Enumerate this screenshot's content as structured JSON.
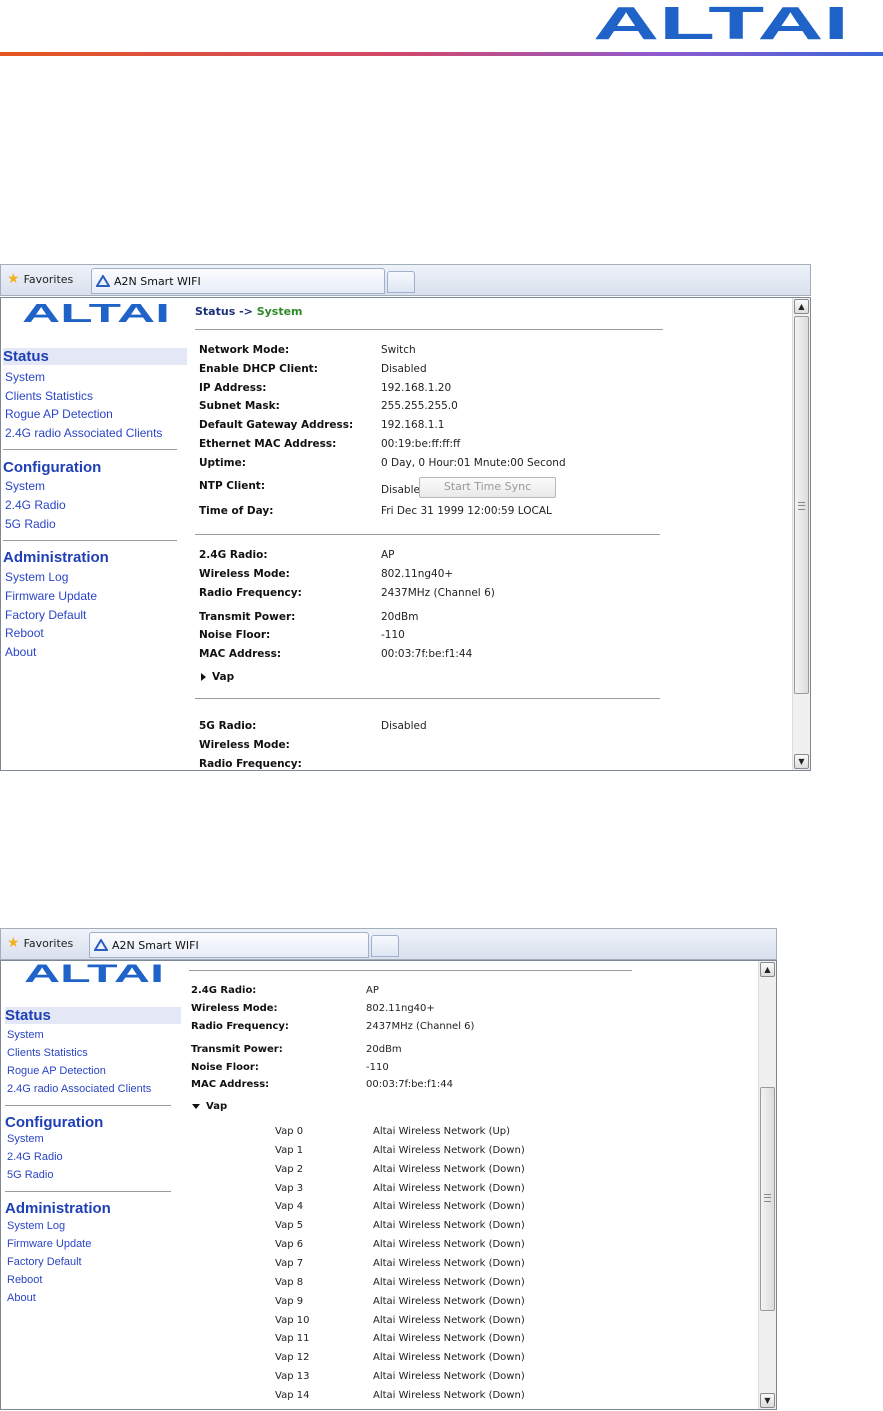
{
  "page_logo": "ALTAI",
  "brand_colors": {
    "logo_blue": "#1f63c9",
    "link": "#2b45c6",
    "heading": "#1f3fb5",
    "crumb_green": "#2f8a27"
  },
  "browser": {
    "favorites_label": "Favorites",
    "tab_title": "A2N Smart WIFI"
  },
  "sidebar": {
    "logo": "ALTAI",
    "status": {
      "title": "Status",
      "items": [
        "System",
        "Clients Statistics",
        "Rogue AP Detection",
        "2.4G radio Associated Clients"
      ]
    },
    "configuration": {
      "title": "Configuration",
      "items": [
        "System",
        "2.4G Radio",
        "5G Radio"
      ]
    },
    "administration": {
      "title": "Administration",
      "items": [
        "System Log",
        "Firmware Update",
        "Factory Default",
        "Reboot",
        "About"
      ]
    }
  },
  "shot1": {
    "breadcrumb": {
      "prefix": "Status ->",
      "current": "System"
    },
    "system": [
      {
        "label": "Network Mode:",
        "value": "Switch"
      },
      {
        "label": "Enable DHCP Client:",
        "value": "Disabled"
      },
      {
        "label": "IP Address:",
        "value": "192.168.1.20"
      },
      {
        "label": "Subnet Mask:",
        "value": "255.255.255.0"
      },
      {
        "label": "Default Gateway Address:",
        "value": "192.168.1.1"
      },
      {
        "label": "Ethernet MAC Address:",
        "value": "00:19:be:ff:ff:ff"
      },
      {
        "label": "Uptime:",
        "value": "0 Day, 0 Hour:01 Mnute:00 Second"
      },
      {
        "label": "NTP Client:",
        "value": "Disable"
      },
      {
        "label": "Time of Day:",
        "value": "Fri Dec 31 1999 12:00:59 LOCAL"
      }
    ],
    "ntp_button": "Start Time Sync",
    "radio24": [
      {
        "label": "2.4G Radio:",
        "value": "AP"
      },
      {
        "label": "Wireless Mode:",
        "value": "802.11ng40+"
      },
      {
        "label": "Radio Frequency:",
        "value": "2437MHz (Channel 6)"
      },
      {
        "label": "Transmit Power:",
        "value": "20dBm"
      },
      {
        "label": "Noise Floor:",
        "value": "-110"
      },
      {
        "label": "MAC Address:",
        "value": "00:03:7f:be:f1:44"
      }
    ],
    "vap_label": "Vap",
    "radio5": [
      {
        "label": "5G Radio:",
        "value": "Disabled"
      },
      {
        "label": "Wireless Mode:",
        "value": ""
      },
      {
        "label": "Radio Frequency:",
        "value": ""
      }
    ]
  },
  "shot2": {
    "radio24": [
      {
        "label": "2.4G Radio:",
        "value": "AP"
      },
      {
        "label": "Wireless Mode:",
        "value": "802.11ng40+"
      },
      {
        "label": "Radio Frequency:",
        "value": "2437MHz (Channel 6)"
      },
      {
        "label": "Transmit Power:",
        "value": "20dBm"
      },
      {
        "label": "Noise Floor:",
        "value": "-110"
      },
      {
        "label": "MAC Address:",
        "value": "00:03:7f:be:f1:44"
      }
    ],
    "vap_label": "Vap",
    "vaps": [
      {
        "name": "Vap 0",
        "status": "Altai Wireless Network (Up)"
      },
      {
        "name": "Vap 1",
        "status": "Altai Wireless Network (Down)"
      },
      {
        "name": "Vap 2",
        "status": "Altai Wireless Network (Down)"
      },
      {
        "name": "Vap 3",
        "status": "Altai Wireless Network (Down)"
      },
      {
        "name": "Vap 4",
        "status": "Altai Wireless Network (Down)"
      },
      {
        "name": "Vap 5",
        "status": "Altai Wireless Network (Down)"
      },
      {
        "name": "Vap 6",
        "status": "Altai Wireless Network (Down)"
      },
      {
        "name": "Vap 7",
        "status": "Altai Wireless Network (Down)"
      },
      {
        "name": "Vap 8",
        "status": "Altai Wireless Network (Down)"
      },
      {
        "name": "Vap 9",
        "status": "Altai Wireless Network (Down)"
      },
      {
        "name": "Vap 10",
        "status": "Altai Wireless Network (Down)"
      },
      {
        "name": "Vap 11",
        "status": "Altai Wireless Network (Down)"
      },
      {
        "name": "Vap 12",
        "status": "Altai Wireless Network (Down)"
      },
      {
        "name": "Vap 13",
        "status": "Altai Wireless Network (Down)"
      },
      {
        "name": "Vap 14",
        "status": "Altai Wireless Network (Down)"
      }
    ]
  }
}
